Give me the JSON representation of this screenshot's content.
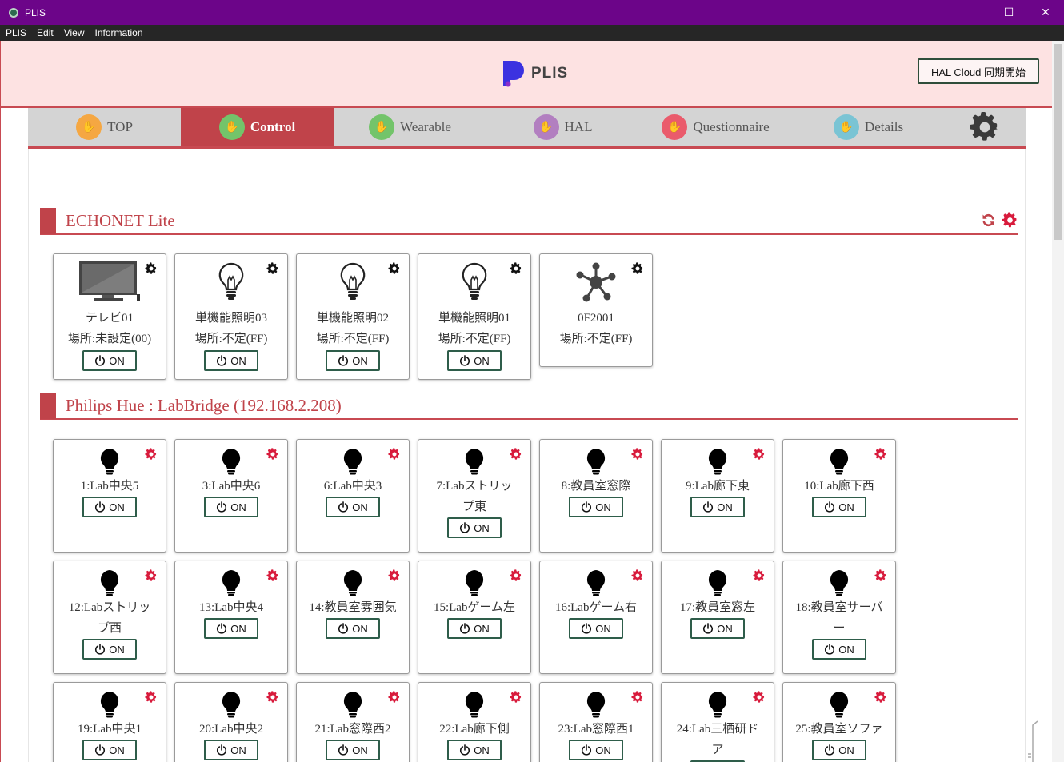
{
  "window": {
    "title": "PLIS",
    "minimize": "—",
    "maximize": "☐",
    "close": "✕"
  },
  "menu": [
    "PLIS",
    "Edit",
    "View",
    "Information"
  ],
  "header": {
    "logo_text": "PLIS",
    "hal_button": "HAL Cloud 同期開始"
  },
  "tabs": [
    {
      "label": "TOP",
      "icon": "hand-wave-icon",
      "color": "orange"
    },
    {
      "label": "Control",
      "icon": "hand-touch-icon",
      "color": "green",
      "active": true
    },
    {
      "label": "Wearable",
      "icon": "hand-touch-icon",
      "color": "green"
    },
    {
      "label": "HAL",
      "icon": "bar-chart-icon",
      "color": "purple"
    },
    {
      "label": "Questionnaire",
      "icon": "people-icon",
      "color": "red"
    },
    {
      "label": "Details",
      "icon": "phone-signal-icon",
      "color": "teal"
    }
  ],
  "echonet": {
    "title": "ECHONET Lite",
    "on_label": "ON",
    "devices": [
      {
        "name": "テレビ01",
        "location": "場所:未設定(00)",
        "icon": "tv-icon"
      },
      {
        "name": "単機能照明03",
        "location": "場所:不定(FF)",
        "icon": "bulb-outline-icon"
      },
      {
        "name": "単機能照明02",
        "location": "場所:不定(FF)",
        "icon": "bulb-outline-icon"
      },
      {
        "name": "単機能照明01",
        "location": "場所:不定(FF)",
        "icon": "bulb-outline-icon"
      },
      {
        "name": "0F2001",
        "location": "場所:不定(FF)",
        "icon": "network-hub-icon"
      }
    ]
  },
  "hue": {
    "title": "Philips Hue : LabBridge (192.168.2.208)",
    "on_label": "ON",
    "lights": [
      {
        "line1": "1:Lab中央5",
        "line2": ""
      },
      {
        "line1": "3:Lab中央6",
        "line2": ""
      },
      {
        "line1": "6:Lab中央3",
        "line2": ""
      },
      {
        "line1": "7:Labストリッ",
        "line2": "プ東"
      },
      {
        "line1": "8:教員室窓際",
        "line2": ""
      },
      {
        "line1": "9:Lab廊下東",
        "line2": ""
      },
      {
        "line1": "10:Lab廊下西",
        "line2": ""
      },
      {
        "line1": "12:Labストリッ",
        "line2": "プ西"
      },
      {
        "line1": "13:Lab中央4",
        "line2": ""
      },
      {
        "line1": "14:教員室雰囲気",
        "line2": ""
      },
      {
        "line1": "15:Labゲーム左",
        "line2": ""
      },
      {
        "line1": "16:Labゲーム右",
        "line2": ""
      },
      {
        "line1": "17:教員室窓左",
        "line2": ""
      },
      {
        "line1": "18:教員室サーバ",
        "line2": "ー"
      },
      {
        "line1": "19:Lab中央1",
        "line2": ""
      },
      {
        "line1": "20:Lab中央2",
        "line2": ""
      },
      {
        "line1": "21:Lab窓際西2",
        "line2": ""
      },
      {
        "line1": "22:Lab廊下側",
        "line2": ""
      },
      {
        "line1": "23:Lab窓際西1",
        "line2": ""
      },
      {
        "line1": "24:Lab三栖研ド",
        "line2": "ア"
      },
      {
        "line1": "25:教員室ソファ",
        "line2": ""
      }
    ]
  },
  "colors": {
    "accent": "#c0434a",
    "titlebar": "#6c0589",
    "header_bg": "#fde2e2",
    "cog_red": "#d81b3c"
  }
}
